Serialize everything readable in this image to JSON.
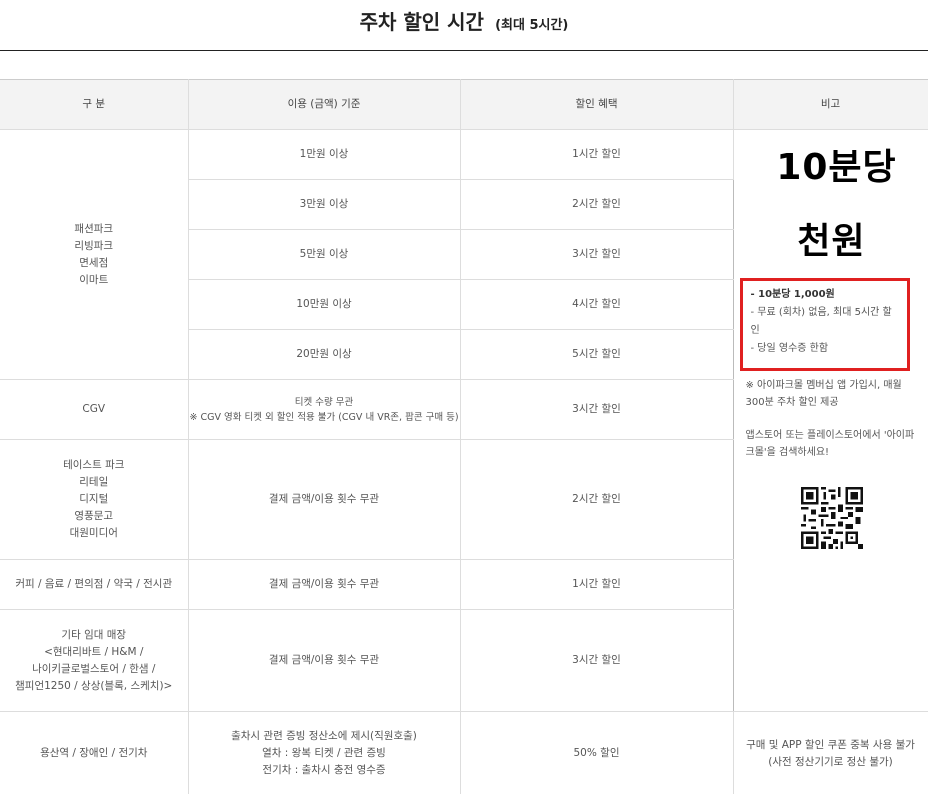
{
  "header": {
    "title_main": "주차 할인 시간",
    "title_sub": "(최대 5시간)"
  },
  "table": {
    "headers": [
      "구 분",
      "이용 (금액) 기준",
      "할인 혜택",
      "비고"
    ],
    "group1": {
      "category_lines": [
        "패션파크",
        "리빙파크",
        "면세점",
        "이마트"
      ],
      "rows": [
        {
          "criteria": "1만원 이상",
          "benefit": "1시간 할인"
        },
        {
          "criteria": "3만원 이상",
          "benefit": "2시간 할인"
        },
        {
          "criteria": "5만원 이상",
          "benefit": "3시간 할인"
        },
        {
          "criteria": "10만원 이상",
          "benefit": "4시간 할인"
        },
        {
          "criteria": "20만원 이상",
          "benefit": "5시간 할인"
        }
      ]
    },
    "cgv": {
      "category": "CGV",
      "criteria_lines": [
        "티켓 수량 무관",
        "※ CGV 영화 티켓 외 할인 적용 불가 (CGV 내 VR존, 팝콘 구매 등)"
      ],
      "benefit": "3시간 할인"
    },
    "group3": {
      "category_lines": [
        "테이스트 파크",
        "리테일",
        "디지털",
        "영풍문고",
        "대원미디어"
      ],
      "criteria": "결제 금액/이용 횟수 무관",
      "benefit": "2시간 할인"
    },
    "group4": {
      "category": "커피 / 음료 / 편의점 / 약국 / 전시관",
      "criteria": "결제 금액/이용 횟수 무관",
      "benefit": "1시간 할인"
    },
    "group5": {
      "category_lines": [
        "기타 임대 매장",
        "<현대리바트 / H&M /",
        "나이키글로벌스토어 / 한샘 /",
        "챔피언1250 / 상상(블록, 스케치)>"
      ],
      "criteria": "결제 금액/이용 횟수 무관",
      "benefit": "3시간 할인"
    },
    "group6": {
      "category": "용산역 / 장애인 / 전기차",
      "criteria_lines": [
        "출차시 관련 증빙 정산소에 제시(직원호출)",
        "열차 : 왕복 티켓 / 관련 증빙",
        "전기차 : 출차시 충전 영수증"
      ],
      "benefit": "50% 할인",
      "remark_lines": [
        "구매 및 APP 할인 쿠폰 중복 사용 불가",
        "(사전 정산기기로 정산 불가)"
      ]
    },
    "remark": {
      "handwrite_line1": "10분당",
      "handwrite_line2": "천원",
      "box_items": [
        "- 10분당 1,000원",
        "- 무료 (회차) 없음, 최대 5시간 할인",
        "- 당일 영수증 한함"
      ],
      "note": "※ 아이파크몰 멤버십 앱 가입시, 매월 300분 주차 할인 제공",
      "note2": "앱스토어 또는 플레이스토어에서 '아이파크몰'을 검색하세요!"
    }
  },
  "colors": {
    "highlight_border": "#e02020",
    "header_bg": "#f3f3f3",
    "rule": "#222222"
  },
  "icons": {
    "qr": "qr-code-icon"
  }
}
